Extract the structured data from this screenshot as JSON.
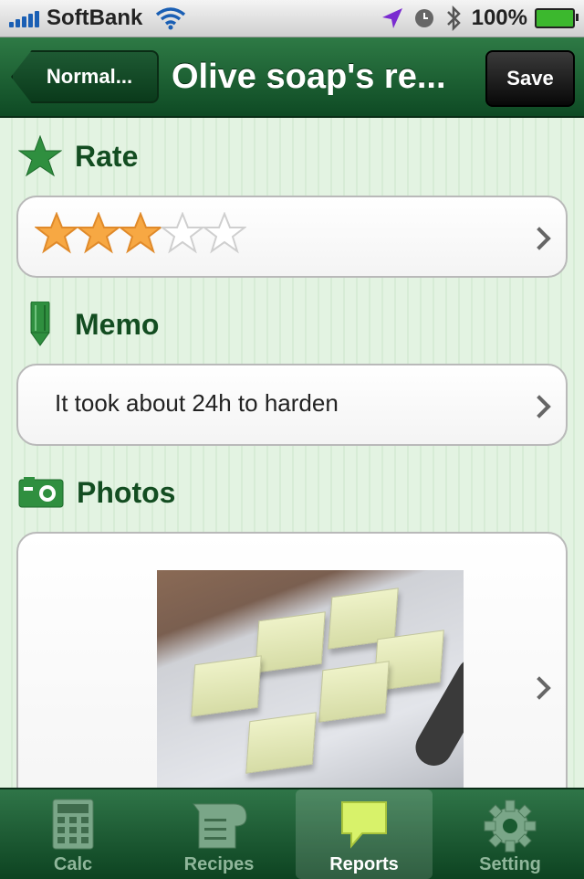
{
  "status_bar": {
    "carrier": "SoftBank",
    "battery": "100%",
    "icons": [
      "signal-bars-icon",
      "wifi-icon",
      "location-arrow-icon",
      "alarm-clock-icon",
      "bluetooth-icon",
      "battery-icon"
    ]
  },
  "nav": {
    "back_label": "Normal...",
    "title": "Olive soap's re...",
    "save_label": "Save"
  },
  "rate": {
    "label": "Rate",
    "rating": 3,
    "max": 5,
    "icon": "star-icon"
  },
  "memo": {
    "label": "Memo",
    "text": "It took about 24h to harden",
    "icon": "pencil-icon"
  },
  "photos": {
    "label": "Photos",
    "icon": "camera-icon"
  },
  "tabs": [
    {
      "label": "Calc",
      "icon": "calculator-icon",
      "selected": false
    },
    {
      "label": "Recipes",
      "icon": "recipe-book-icon",
      "selected": false
    },
    {
      "label": "Reports",
      "icon": "speech-bubble-icon",
      "selected": true
    },
    {
      "label": "Setting",
      "icon": "gear-icon",
      "selected": false
    }
  ],
  "colors": {
    "nav_green": "#1b5e33",
    "heading_green": "#134d21",
    "star_filled": "#f7a843",
    "tab_selected": "#ffffff"
  }
}
